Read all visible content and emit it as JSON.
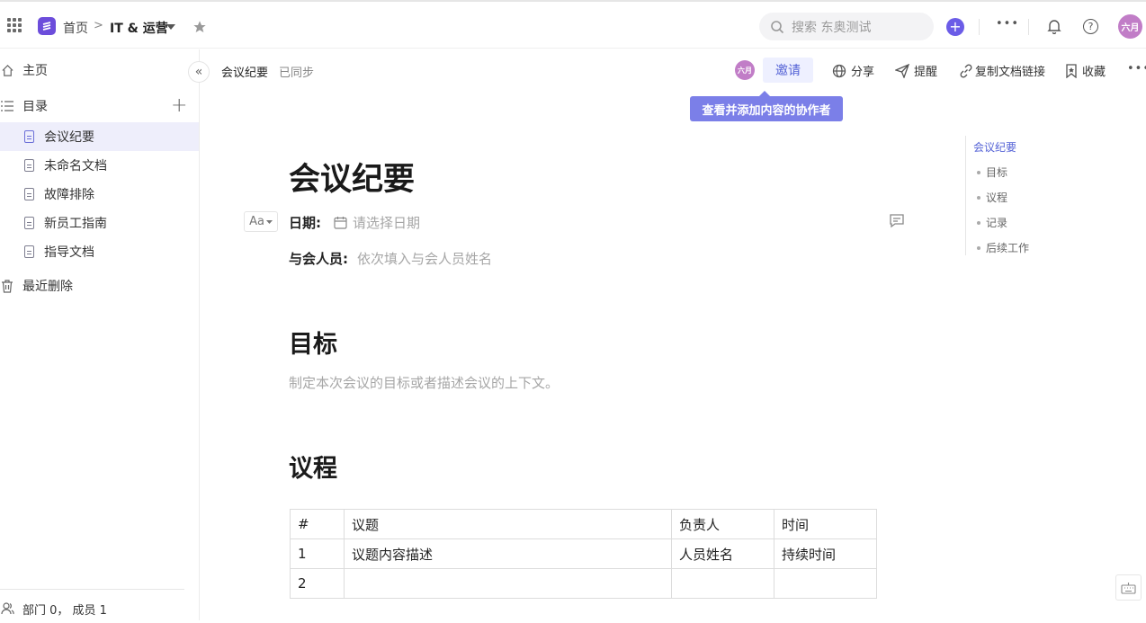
{
  "topbar": {
    "breadcrumb_home": "首页",
    "breadcrumb_sep": ">",
    "workspace": "IT & 运营",
    "search_placeholder": "搜索 东奥测试",
    "plus_label": "+",
    "more_label": "•••",
    "help_label": "?",
    "avatar_text": "六月"
  },
  "sidebar": {
    "home": "主页",
    "catalog": "目录",
    "add_label": "+",
    "collapse_label": "«",
    "items": [
      {
        "label": "会议纪要",
        "active": true
      },
      {
        "label": "未命名文档"
      },
      {
        "label": "故障排除"
      },
      {
        "label": "新员工指南"
      },
      {
        "label": "指导文档"
      }
    ],
    "trash": "最近删除",
    "footer": "部门 0， 成员 1"
  },
  "doc_header": {
    "title": "会议纪要",
    "status": "已同步",
    "avatar_text": "六月",
    "invite": "邀请",
    "share": "分享",
    "remind": "提醒",
    "copy_link": "复制文档链接",
    "favorite": "收藏",
    "more": "•••",
    "tooltip": "查看并添加内容的协作者"
  },
  "document": {
    "title": "会议纪要",
    "format_button": "Aa",
    "date_label": "日期:",
    "date_placeholder": "请选择日期",
    "attendees_label": "与会人员:",
    "attendees_placeholder": "依次填入与会人员姓名",
    "goal_heading": "目标",
    "goal_placeholder": "制定本次会议的目标或者描述会议的上下文。",
    "agenda_heading": "议程",
    "table": {
      "headers": [
        "#",
        "议题",
        "负责人",
        "时间"
      ],
      "rows": [
        [
          "1",
          "议题内容描述",
          "人员姓名",
          "持续时间"
        ],
        [
          "2",
          "",
          "",
          ""
        ]
      ]
    }
  },
  "toc": {
    "items": [
      "会议纪要",
      "目标",
      "议程",
      "记录",
      "后续工作"
    ]
  },
  "colors": {
    "accent": "#6b5ce7",
    "active_bg": "#eeeefb",
    "tooltip_bg": "#7b7fe8"
  }
}
